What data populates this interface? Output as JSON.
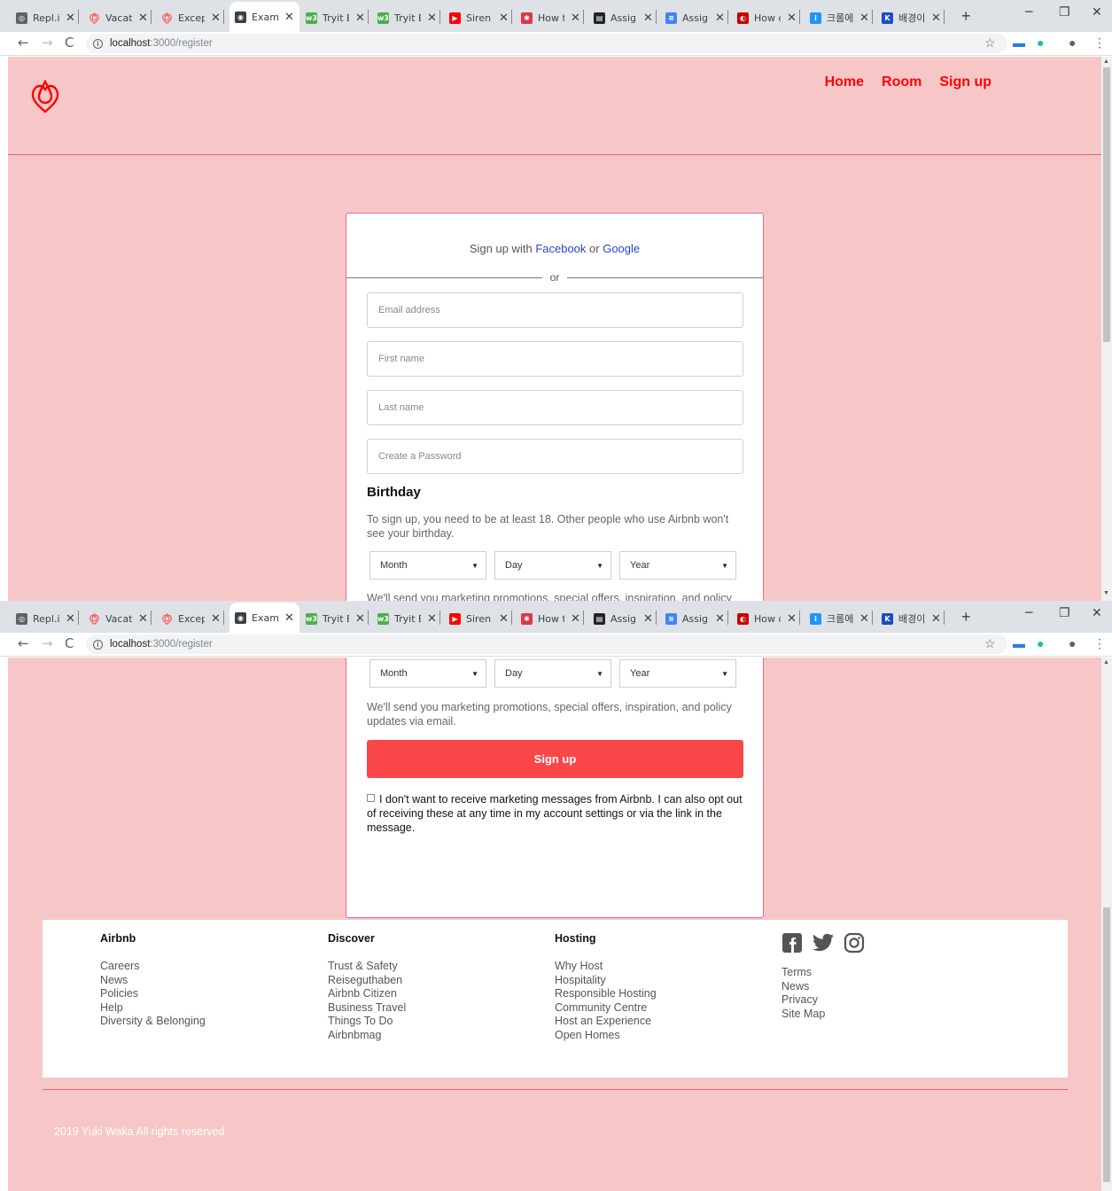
{
  "browser": {
    "tabs": [
      {
        "title": "Repl.it",
        "color": "#5f6368",
        "glyph": "◎",
        "active": false
      },
      {
        "title": "Vacatio",
        "color": "#ff5a5f",
        "glyph": "",
        "active": false
      },
      {
        "title": "Excepti",
        "color": "#ff5a5f",
        "glyph": "",
        "active": false
      },
      {
        "title": "Examp",
        "color": "#3c4043",
        "glyph": "◉",
        "active": true
      },
      {
        "title": "Tryit E",
        "color": "#4caf50",
        "glyph": "w3",
        "active": false
      },
      {
        "title": "Tryit E",
        "color": "#4caf50",
        "glyph": "w3",
        "active": false
      },
      {
        "title": "Siren (",
        "color": "#ff0000",
        "glyph": "▶",
        "active": false
      },
      {
        "title": "How t",
        "color": "#d73a49",
        "glyph": "✱",
        "active": false
      },
      {
        "title": "Assign",
        "color": "#222222",
        "glyph": "▤",
        "active": false
      },
      {
        "title": "Assign",
        "color": "#4285f4",
        "glyph": "≡",
        "active": false
      },
      {
        "title": "How d",
        "color": "#cc0000",
        "glyph": "◐",
        "active": false
      },
      {
        "title": "크롬에",
        "color": "#2196f3",
        "glyph": "i",
        "active": false
      },
      {
        "title": "배경이",
        "color": "#1a4fc4",
        "glyph": "K",
        "active": false
      }
    ],
    "url_host": "localhost",
    "url_path": ":3000/register"
  },
  "site": {
    "nav": [
      "Home",
      "Room",
      "Sign up"
    ],
    "brand_color": "#ff0000"
  },
  "form": {
    "social_prefix": "Sign up with",
    "facebook": "Facebook",
    "or_word": "or",
    "google": "Google",
    "divider_or": "or",
    "email_placeholder": "Email address",
    "first_name_placeholder": "First name",
    "last_name_placeholder": "Last name",
    "password_placeholder": "Create a Password",
    "birthday_title": "Birthday",
    "birthday_note": "To sign up, you need to be at least 18. Other people who use Airbnb won't see your birthday.",
    "month": "Month",
    "day": "Day",
    "year": "Year",
    "marketing_note": "We'll send you marketing promotions, special offers, inspiration, and policy updates via email.",
    "signup_button": "Sign up",
    "optout_text": "I don't want to receive marketing messages from Airbnb. I can also opt out of receiving these at any time in my account settings or via the link in the message."
  },
  "footer": {
    "columns": [
      {
        "title": "Airbnb",
        "links": [
          "Careers",
          "News",
          "Policies",
          "Help",
          "Diversity & Belonging"
        ]
      },
      {
        "title": "Discover",
        "links": [
          "Trust & Safety",
          "Reiseguthaben",
          "Airbnb Citizen",
          "Business Travel",
          "Things To Do",
          "Airbnbmag"
        ]
      },
      {
        "title": "Hosting",
        "links": [
          "Why Host",
          "Hospitality",
          "Responsible Hosting",
          "Community Centre",
          "Host an Experience",
          "Open Homes"
        ]
      }
    ],
    "extra_links": [
      "Terms",
      "News",
      "Privacy",
      "Site Map"
    ],
    "social_icons": [
      "facebook-icon",
      "twitter-icon",
      "instagram-icon"
    ],
    "copyright": "2019 Yuki Waka All rights reserved"
  }
}
